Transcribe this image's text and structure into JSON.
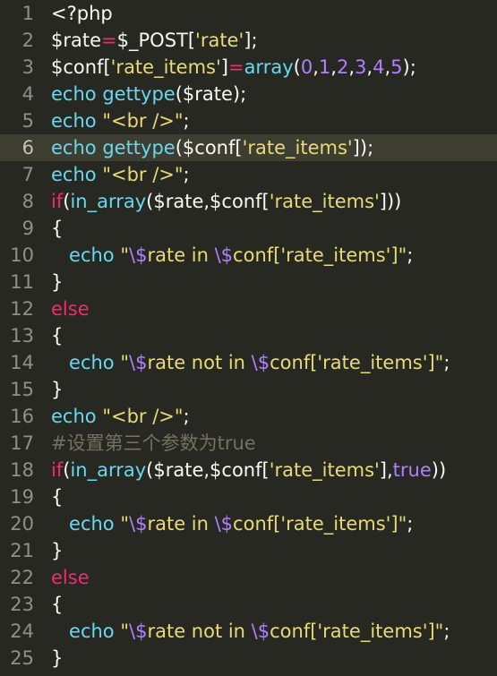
{
  "editor": {
    "current_line": 6,
    "colors": {
      "background": "#272822",
      "current_line": "#3e3d32",
      "gutter_text": "#8f908a",
      "plain": "#f8f8f2",
      "keyword": "#f92672",
      "function": "#66d9ef",
      "string": "#e6db74",
      "number": "#ae81ff",
      "comment": "#75715e"
    },
    "lines": [
      {
        "num": "1",
        "tokens": [
          {
            "t": "<?php",
            "c": "plain"
          }
        ]
      },
      {
        "num": "2",
        "tokens": [
          {
            "t": "$rate",
            "c": "plain"
          },
          {
            "t": "=",
            "c": "op"
          },
          {
            "t": "$_POST[",
            "c": "plain"
          },
          {
            "t": "'rate'",
            "c": "str"
          },
          {
            "t": "];",
            "c": "plain"
          }
        ]
      },
      {
        "num": "3",
        "tokens": [
          {
            "t": "$conf[",
            "c": "plain"
          },
          {
            "t": "'rate_items'",
            "c": "str"
          },
          {
            "t": "]",
            "c": "plain"
          },
          {
            "t": "=",
            "c": "op"
          },
          {
            "t": "array",
            "c": "fn"
          },
          {
            "t": "(",
            "c": "plain"
          },
          {
            "t": "0",
            "c": "num"
          },
          {
            "t": ",",
            "c": "plain"
          },
          {
            "t": "1",
            "c": "num"
          },
          {
            "t": ",",
            "c": "plain"
          },
          {
            "t": "2",
            "c": "num"
          },
          {
            "t": ",",
            "c": "plain"
          },
          {
            "t": "3",
            "c": "num"
          },
          {
            "t": ",",
            "c": "plain"
          },
          {
            "t": "4",
            "c": "num"
          },
          {
            "t": ",",
            "c": "plain"
          },
          {
            "t": "5",
            "c": "num"
          },
          {
            "t": ");",
            "c": "plain"
          }
        ]
      },
      {
        "num": "4",
        "tokens": [
          {
            "t": "echo",
            "c": "echo"
          },
          {
            "t": " ",
            "c": "plain"
          },
          {
            "t": "gettype",
            "c": "fn"
          },
          {
            "t": "($rate);",
            "c": "plain"
          }
        ]
      },
      {
        "num": "5",
        "tokens": [
          {
            "t": "echo",
            "c": "echo"
          },
          {
            "t": " ",
            "c": "plain"
          },
          {
            "t": "\"<br />\"",
            "c": "str"
          },
          {
            "t": ";",
            "c": "plain"
          }
        ]
      },
      {
        "num": "6",
        "tokens": [
          {
            "t": "echo",
            "c": "echo"
          },
          {
            "t": " ",
            "c": "plain"
          },
          {
            "t": "gettype",
            "c": "fn"
          },
          {
            "t": "($conf",
            "c": "plain"
          },
          {
            "t": "[",
            "c": "bracket"
          },
          {
            "t": "'rate_items'",
            "c": "str"
          },
          {
            "t": "]",
            "c": "bracket"
          },
          {
            "t": ");",
            "c": "plain"
          }
        ]
      },
      {
        "num": "7",
        "tokens": [
          {
            "t": "echo",
            "c": "echo"
          },
          {
            "t": " ",
            "c": "plain"
          },
          {
            "t": "\"<br />\"",
            "c": "str"
          },
          {
            "t": ";",
            "c": "plain"
          }
        ]
      },
      {
        "num": "8",
        "tokens": [
          {
            "t": "if",
            "c": "kw"
          },
          {
            "t": "(",
            "c": "plain"
          },
          {
            "t": "in_array",
            "c": "fn"
          },
          {
            "t": "($rate,$conf[",
            "c": "plain"
          },
          {
            "t": "'rate_items'",
            "c": "str"
          },
          {
            "t": "]))",
            "c": "plain"
          }
        ]
      },
      {
        "num": "9",
        "tokens": [
          {
            "t": "{",
            "c": "plain"
          }
        ]
      },
      {
        "num": "10",
        "tokens": [
          {
            "t": "   ",
            "c": "plain"
          },
          {
            "t": "echo",
            "c": "echo"
          },
          {
            "t": " ",
            "c": "plain"
          },
          {
            "t": "\"",
            "c": "str"
          },
          {
            "t": "\\$",
            "c": "esc"
          },
          {
            "t": "rate in ",
            "c": "str"
          },
          {
            "t": "\\$",
            "c": "esc"
          },
          {
            "t": "conf['rate_items']\"",
            "c": "str"
          },
          {
            "t": ";",
            "c": "plain"
          }
        ]
      },
      {
        "num": "11",
        "tokens": [
          {
            "t": "}",
            "c": "plain"
          }
        ]
      },
      {
        "num": "12",
        "tokens": [
          {
            "t": "else",
            "c": "kw"
          }
        ]
      },
      {
        "num": "13",
        "tokens": [
          {
            "t": "{",
            "c": "plain"
          }
        ]
      },
      {
        "num": "14",
        "tokens": [
          {
            "t": "   ",
            "c": "plain"
          },
          {
            "t": "echo",
            "c": "echo"
          },
          {
            "t": " ",
            "c": "plain"
          },
          {
            "t": "\"",
            "c": "str"
          },
          {
            "t": "\\$",
            "c": "esc"
          },
          {
            "t": "rate not in ",
            "c": "str"
          },
          {
            "t": "\\$",
            "c": "esc"
          },
          {
            "t": "conf['rate_items']\"",
            "c": "str"
          },
          {
            "t": ";",
            "c": "plain"
          }
        ]
      },
      {
        "num": "15",
        "tokens": [
          {
            "t": "}",
            "c": "plain"
          }
        ]
      },
      {
        "num": "16",
        "tokens": [
          {
            "t": "echo",
            "c": "echo"
          },
          {
            "t": " ",
            "c": "plain"
          },
          {
            "t": "\"<br />\"",
            "c": "str"
          },
          {
            "t": ";",
            "c": "plain"
          }
        ]
      },
      {
        "num": "17",
        "tokens": [
          {
            "t": "#设置第三个参数为true",
            "c": "comment"
          }
        ]
      },
      {
        "num": "18",
        "tokens": [
          {
            "t": "if",
            "c": "kw"
          },
          {
            "t": "(",
            "c": "plain"
          },
          {
            "t": "in_array",
            "c": "fn"
          },
          {
            "t": "($rate,$conf[",
            "c": "plain"
          },
          {
            "t": "'rate_items'",
            "c": "str"
          },
          {
            "t": "],",
            "c": "plain"
          },
          {
            "t": "true",
            "c": "const"
          },
          {
            "t": "))",
            "c": "plain"
          }
        ]
      },
      {
        "num": "19",
        "tokens": [
          {
            "t": "{",
            "c": "plain"
          }
        ]
      },
      {
        "num": "20",
        "tokens": [
          {
            "t": "   ",
            "c": "plain"
          },
          {
            "t": "echo",
            "c": "echo"
          },
          {
            "t": " ",
            "c": "plain"
          },
          {
            "t": "\"",
            "c": "str"
          },
          {
            "t": "\\$",
            "c": "esc"
          },
          {
            "t": "rate in ",
            "c": "str"
          },
          {
            "t": "\\$",
            "c": "esc"
          },
          {
            "t": "conf['rate_items']\"",
            "c": "str"
          },
          {
            "t": ";",
            "c": "plain"
          }
        ]
      },
      {
        "num": "21",
        "tokens": [
          {
            "t": "}",
            "c": "plain"
          }
        ]
      },
      {
        "num": "22",
        "tokens": [
          {
            "t": "else",
            "c": "kw"
          }
        ]
      },
      {
        "num": "23",
        "tokens": [
          {
            "t": "{",
            "c": "plain"
          }
        ]
      },
      {
        "num": "24",
        "tokens": [
          {
            "t": "   ",
            "c": "plain"
          },
          {
            "t": "echo",
            "c": "echo"
          },
          {
            "t": " ",
            "c": "plain"
          },
          {
            "t": "\"",
            "c": "str"
          },
          {
            "t": "\\$",
            "c": "esc"
          },
          {
            "t": "rate not in ",
            "c": "str"
          },
          {
            "t": "\\$",
            "c": "esc"
          },
          {
            "t": "conf['rate_items']\"",
            "c": "str"
          },
          {
            "t": ";",
            "c": "plain"
          }
        ]
      },
      {
        "num": "25",
        "tokens": [
          {
            "t": "}",
            "c": "plain"
          }
        ]
      }
    ]
  }
}
